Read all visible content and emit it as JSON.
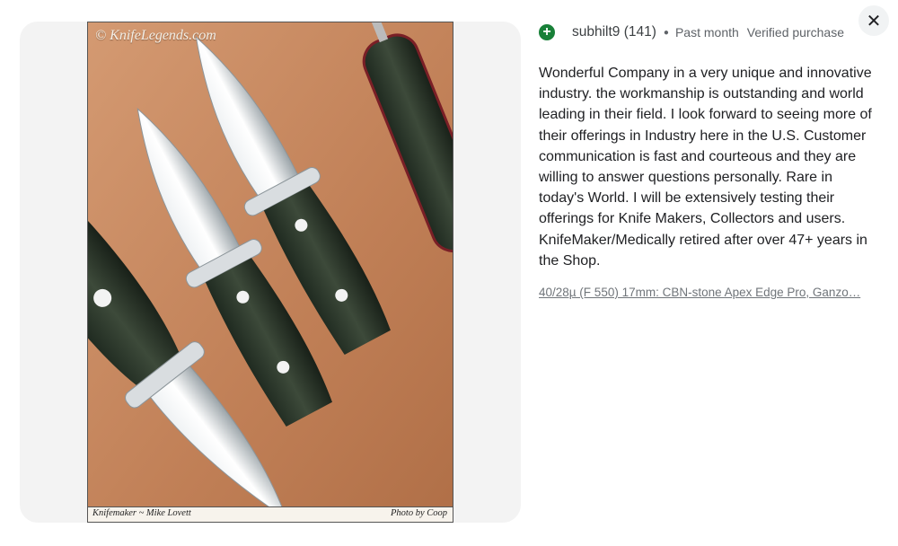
{
  "image": {
    "watermark": "© KnifeLegends.com",
    "caption_left": "Knifemaker ~ Mike Lovett",
    "caption_right": "Photo by Coop"
  },
  "review": {
    "author": "subhilt9 (141)",
    "time": "Past month",
    "badge": "Verified purchase",
    "body": "Wonderful Company in a very unique and innovative industry. the workmanship is outstanding and world leading in their field. I look forward to seeing more of their offerings in Industry here in the U.S. Customer communication is fast and courteous and they are willing to answer questions personally. Rare in today's World. I will be extensively testing their offerings for Knife Makers, Collectors and users. KnifeMaker/Medically retired after over 47+ years in the Shop.",
    "product_link": "40/28µ (F 550) 17mm: CBN-stone Apex Edge Pro, Ganzo…"
  },
  "close_icon": "close-icon",
  "plus_icon": "plus-icon",
  "colors": {
    "plus_badge": "#188038",
    "background_panel": "#f3f3f3",
    "text": "#202124",
    "muted": "#5f6368"
  }
}
